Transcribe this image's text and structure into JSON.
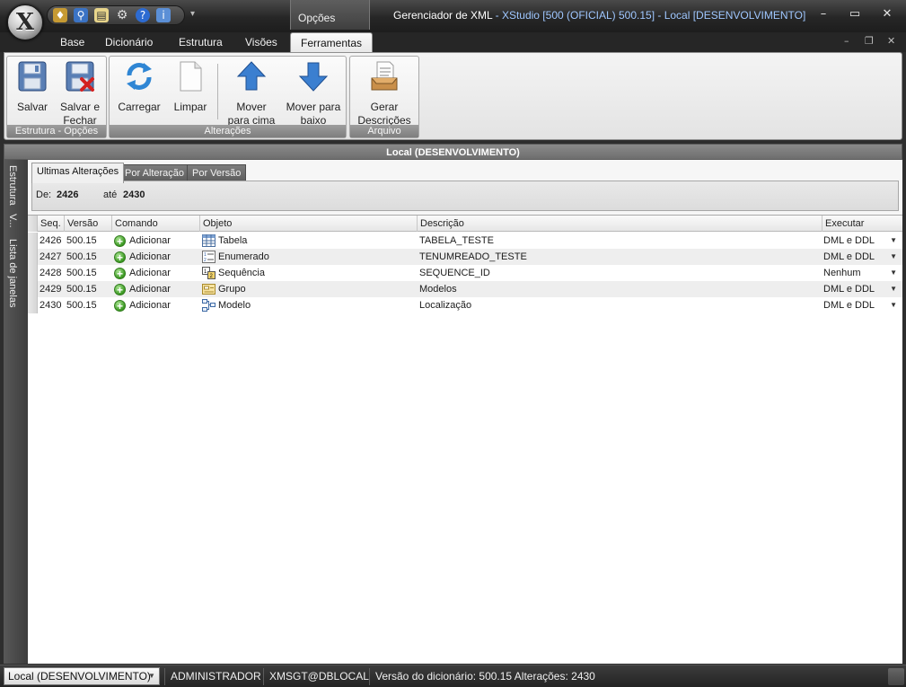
{
  "window": {
    "title": "Gerenciador de XML",
    "subtitle": " - XStudio [500 (OFICIAL) 500.15] - Local [DESENVOLVIMENTO]",
    "minimize": "–",
    "maximize": "▭",
    "close": "✕"
  },
  "context_group": "Opções",
  "ribbon_tabs": [
    "Base",
    "Dicionário",
    "Estrutura",
    "Visões",
    "Ferramentas"
  ],
  "ribbon_active_tab": "Ferramentas",
  "ribbon_groups": {
    "estrutura": {
      "label": "Estrutura - Opções",
      "salvar": "Salvar",
      "salvar_fechar": "Salvar e Fechar"
    },
    "alteracoes": {
      "label": "Alterações",
      "carregar": "Carregar",
      "limpar": "Limpar",
      "mover_cima": "Mover para cima",
      "mover_baixo": "Mover para baixo"
    },
    "arquivo": {
      "label": "Arquivo",
      "gerar": "Gerar Descrições"
    }
  },
  "panel_title": "Local (DESENVOLVIMENTO)",
  "side_tabs": [
    "Estrutura",
    "V...",
    "Lista de janelas"
  ],
  "sub_tabs": [
    "Ultimas Alterações",
    "Por Alteração",
    "Por Versão"
  ],
  "range": {
    "de_label": "De:",
    "de_value": "2426",
    "ate_label": "até",
    "ate_value": "2430"
  },
  "grid": {
    "columns": [
      "Seq.",
      "Versão",
      "Comando",
      "Objeto",
      "Descrição",
      "Executar"
    ],
    "rows": [
      {
        "seq": "2426",
        "versao": "500.15",
        "comando": "Adicionar",
        "objeto": "Tabela",
        "objeto_icon": "table-icon",
        "descricao": "TABELA_TESTE",
        "executar": "DML e DDL"
      },
      {
        "seq": "2427",
        "versao": "500.15",
        "comando": "Adicionar",
        "objeto": "Enumerado",
        "objeto_icon": "enum-icon",
        "descricao": "TENUMREADO_TESTE",
        "executar": "DML e DDL"
      },
      {
        "seq": "2428",
        "versao": "500.15",
        "comando": "Adicionar",
        "objeto": "Sequência",
        "objeto_icon": "sequence-icon",
        "descricao": "SEQUENCE_ID",
        "executar": "Nenhum"
      },
      {
        "seq": "2429",
        "versao": "500.15",
        "comando": "Adicionar",
        "objeto": "Grupo",
        "objeto_icon": "group-icon",
        "descricao": "Modelos",
        "executar": "DML e DDL"
      },
      {
        "seq": "2430",
        "versao": "500.15",
        "comando": "Adicionar",
        "objeto": "Modelo",
        "objeto_icon": "model-icon",
        "descricao": "Localização",
        "executar": "DML e DDL"
      }
    ]
  },
  "status": {
    "connection": "Local (DESENVOLVIMENTO)",
    "user": "ADMINISTRADOR",
    "database": "XMSGT@DBLOCAL",
    "info": "Versão do dicionário: 500.15 Alterações: 2430"
  },
  "colors": {
    "title_accent": "#9fc7ff",
    "add_green": "#3d9a24",
    "ribbon_label": "#8a8a8a"
  }
}
